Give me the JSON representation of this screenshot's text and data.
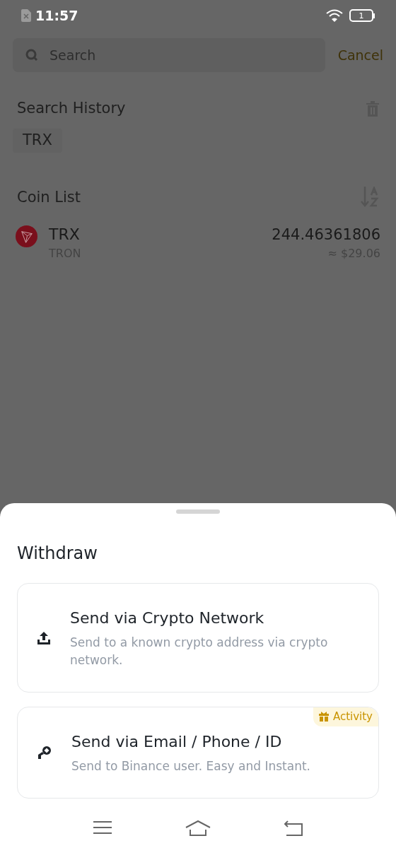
{
  "status_bar": {
    "time": "11:57",
    "battery": "1"
  },
  "search": {
    "placeholder": "Search",
    "cancel": "Cancel"
  },
  "history": {
    "title": "Search History",
    "items": [
      "TRX"
    ]
  },
  "coin_list": {
    "title": "Coin List",
    "coins": [
      {
        "symbol": "TRX",
        "name": "TRON",
        "amount": "244.46361806",
        "value": "≈ $29.06"
      }
    ]
  },
  "sheet": {
    "title": "Withdraw",
    "options": [
      {
        "kind": "upload",
        "title": "Send via Crypto Network",
        "description": "Send to a known crypto address via crypto network."
      },
      {
        "kind": "transfer",
        "title": "Send via Email / Phone / ID",
        "description": "Send to Binance user. Easy and Instant.",
        "badge": "Activity"
      }
    ]
  }
}
